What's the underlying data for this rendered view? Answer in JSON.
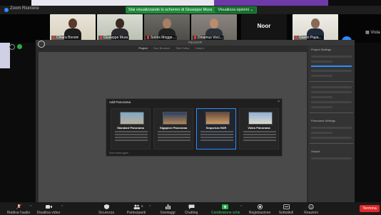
{
  "window": {
    "title": "Zoom Riunione"
  },
  "share_banner": {
    "message": "Stai visualizzando lo schermo di Giuseppe Mura",
    "options_label": "Visualizza opzioni ⌄"
  },
  "gallery": {
    "view_label": "Vista",
    "participants": [
      {
        "name": "Chiara Borsini",
        "muted": true
      },
      {
        "name": "Giuseppe Mura",
        "muted": true
      },
      {
        "name": "Sotiris Mogge...",
        "muted": true
      },
      {
        "name": "Dinamus Voci...",
        "muted": true
      },
      {
        "name": "Noor",
        "muted": false,
        "video_off": true
      },
      {
        "name": "Gianni Papa...",
        "muted": true
      }
    ]
  },
  "shared_app": {
    "title": "Pano2VR",
    "tabs": [
      "Project",
      "Tour Browser",
      "Skin Editor",
      "Output"
    ],
    "active_tab": "Project",
    "panel_title": "Project Settings",
    "panel_sections": [
      "Panorama Settings",
      "Output"
    ]
  },
  "modal": {
    "title": "Add Panorama",
    "close_label": "×",
    "footer_label": "Don't show again",
    "cards": [
      {
        "title": "Standard Panorama",
        "selected": false
      },
      {
        "title": "Gigapixel Panorama",
        "selected": false
      },
      {
        "title": "Sequenza HDR",
        "selected": true
      },
      {
        "title": "Video Panorama",
        "selected": false
      }
    ]
  },
  "toolbar": {
    "items": [
      {
        "label": "Riattiva l'audio",
        "icon": "mic-off-icon"
      },
      {
        "label": "Disattiva video",
        "icon": "video-camera-icon"
      },
      {
        "label": "Sicurezza",
        "icon": "shield-icon"
      },
      {
        "label": "Partecipanti",
        "icon": "participants-icon",
        "count": "5"
      },
      {
        "label": "Sondaggi",
        "icon": "polls-icon"
      },
      {
        "label": "Chatting",
        "icon": "chat-icon"
      },
      {
        "label": "Condivisione schermo",
        "icon": "share-screen-icon"
      },
      {
        "label": "Registrazione",
        "icon": "record-icon"
      },
      {
        "label": "Sottotitoli",
        "icon": "captions-icon"
      },
      {
        "label": "Reazioni",
        "icon": "reactions-icon"
      }
    ],
    "end_label": "Termina"
  },
  "colors": {
    "accent": "#2d8cff",
    "share_green": "#1f8a3a",
    "end_red": "#e02828",
    "mute_red": "#e53935"
  }
}
